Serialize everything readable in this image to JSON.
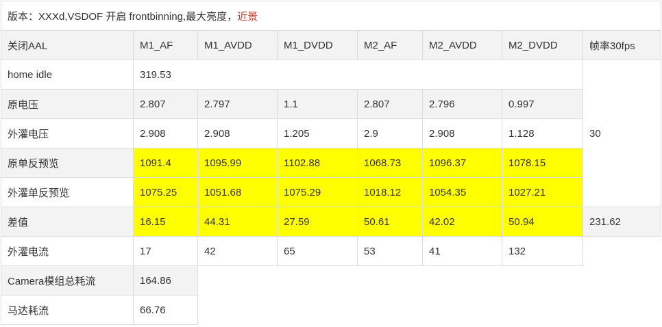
{
  "caption": {
    "main": "版本：XXXd,VSDOF 开启 frontbinning,最大亮度，",
    "highlight": "近景",
    "highlight_color": "#c0392b"
  },
  "highlight_color": "#ffff00",
  "headers": [
    "关闭AAL",
    "M1_AF",
    "M1_AVDD",
    "M1_DVDD",
    "M2_AF",
    "M2_AVDD",
    "M2_DVDD",
    "帧率30fps"
  ],
  "rows": {
    "home_idle": {
      "label": "home idle",
      "value": "319.53"
    },
    "orig_voltage": {
      "label": "原电压",
      "values": [
        "2.807",
        "2.797",
        "1.1",
        "2.807",
        "2.796",
        "0.997"
      ]
    },
    "ext_voltage": {
      "label": "外灌电压",
      "values": [
        "2.908",
        "2.908",
        "1.205",
        "2.9",
        "2.908",
        "1.128"
      ]
    },
    "fps_value": "30",
    "orig_preview": {
      "label": "原单反预览",
      "values": [
        "1091.4",
        "1095.99",
        "1102.88",
        "1068.73",
        "1096.37",
        "1078.15"
      ]
    },
    "ext_preview": {
      "label": "外灌单反预览",
      "values": [
        "1075.25",
        "1051.68",
        "1075.29",
        "1018.12",
        "1054.35",
        "1027.21"
      ]
    },
    "diff": {
      "label": "差值",
      "values": [
        "16.15",
        "44.31",
        "27.59",
        "50.61",
        "42.02",
        "50.94"
      ],
      "total": "231.62"
    },
    "ext_current": {
      "label": "外灌电流",
      "values": [
        "17",
        "42",
        "65",
        "53",
        "41",
        "132"
      ]
    },
    "camera_total": {
      "label": "Camera模组总耗流",
      "value": "164.86"
    },
    "motor": {
      "label": "马达耗流",
      "value": "66.76"
    }
  }
}
